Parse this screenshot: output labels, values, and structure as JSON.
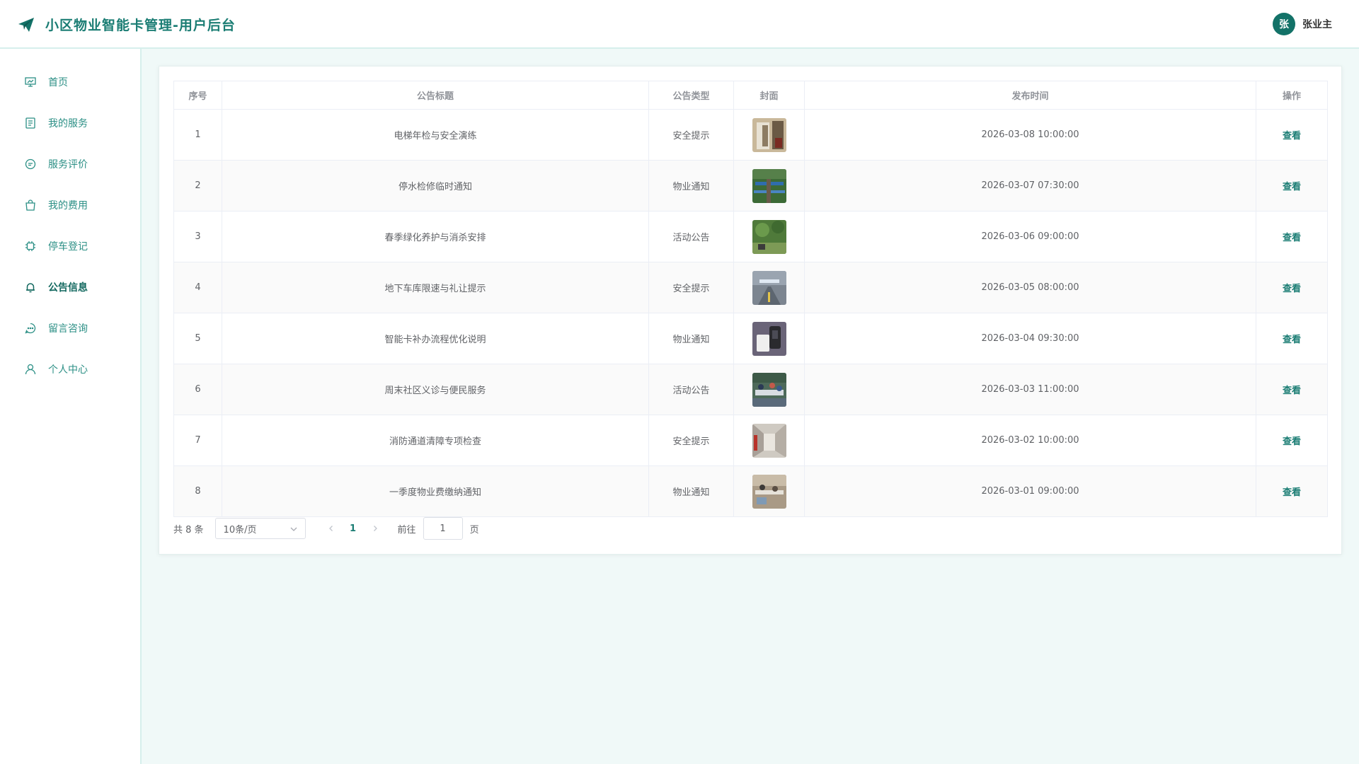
{
  "header": {
    "title": "小区物业智能卡管理-用户后台",
    "avatar_text": "张",
    "user_name": "张业主",
    "accent": "#1b7d74"
  },
  "sidebar": {
    "items": [
      {
        "label": "首页",
        "icon": "dashboard-icon",
        "active": false
      },
      {
        "label": "我的服务",
        "icon": "document-icon",
        "active": false
      },
      {
        "label": "服务评价",
        "icon": "comment-icon",
        "active": false
      },
      {
        "label": "我的费用",
        "icon": "shopping-bag-icon",
        "active": false
      },
      {
        "label": "停车登记",
        "icon": "cpu-icon",
        "active": false
      },
      {
        "label": "公告信息",
        "icon": "bell-icon",
        "active": true
      },
      {
        "label": "留言咨询",
        "icon": "chat-dots-icon",
        "active": false
      },
      {
        "label": "个人中心",
        "icon": "user-icon",
        "active": false
      }
    ]
  },
  "table": {
    "columns": [
      "序号",
      "公告标题",
      "公告类型",
      "封面",
      "发布时间",
      "操作"
    ],
    "rows": [
      {
        "index": "1",
        "title": "电梯年检与安全演练",
        "type": "安全提示",
        "time": "2026-03-08 10:00:00",
        "action": "查看",
        "cover": "elevator-photo"
      },
      {
        "index": "2",
        "title": "停水检修临时通知",
        "type": "物业通知",
        "time": "2026-03-07 07:30:00",
        "action": "查看",
        "cover": "pipe-photo"
      },
      {
        "index": "3",
        "title": "春季绿化养护与消杀安排",
        "type": "活动公告",
        "time": "2026-03-06 09:00:00",
        "action": "查看",
        "cover": "garden-photo"
      },
      {
        "index": "4",
        "title": "地下车库限速与礼让提示",
        "type": "安全提示",
        "time": "2026-03-05 08:00:00",
        "action": "查看",
        "cover": "garage-photo"
      },
      {
        "index": "5",
        "title": "智能卡补办流程优化说明",
        "type": "物业通知",
        "time": "2026-03-04 09:30:00",
        "action": "查看",
        "cover": "card-reader-photo"
      },
      {
        "index": "6",
        "title": "周末社区义诊与便民服务",
        "type": "活动公告",
        "time": "2026-03-03 11:00:00",
        "action": "查看",
        "cover": "clinic-photo"
      },
      {
        "index": "7",
        "title": "消防通道清障专项检查",
        "type": "安全提示",
        "time": "2026-03-02 10:00:00",
        "action": "查看",
        "cover": "corridor-photo"
      },
      {
        "index": "8",
        "title": "一季度物业费缴纳通知",
        "type": "物业通知",
        "time": "2026-03-01 09:00:00",
        "action": "查看",
        "cover": "office-photo"
      }
    ]
  },
  "pagination": {
    "total_text": "共 8 条",
    "page_size": "10条/页",
    "current_page": "1",
    "goto_label": "前往",
    "goto_value": "1",
    "page_suffix": "页"
  }
}
